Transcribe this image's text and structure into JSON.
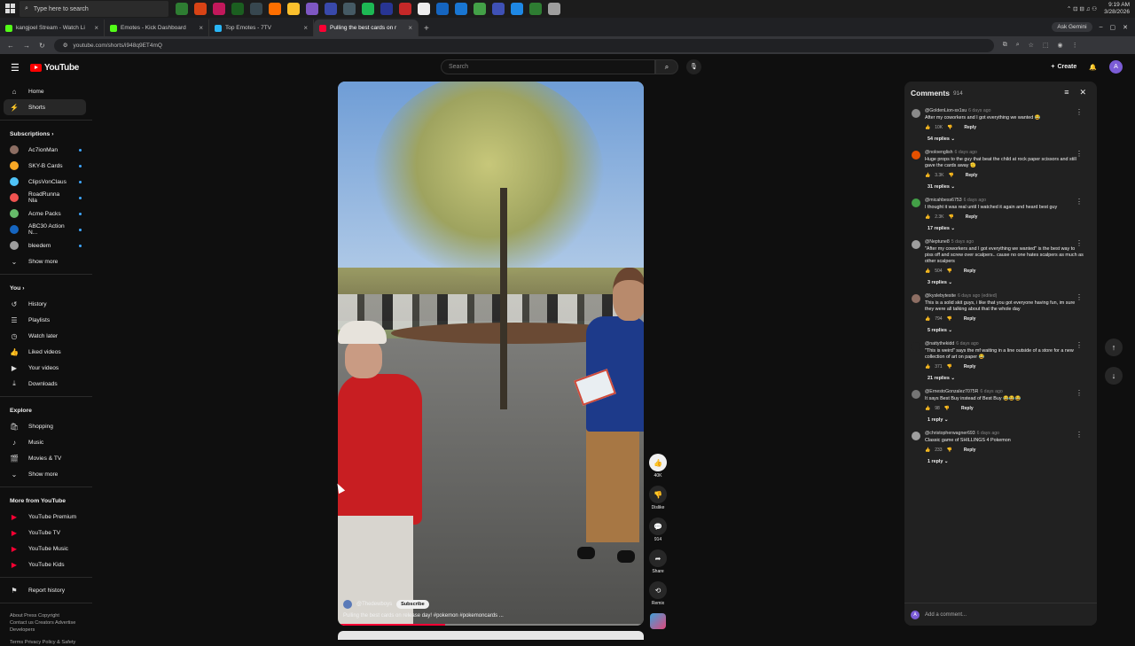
{
  "taskbar": {
    "search_placeholder": "Type here to search",
    "time": "9:19 AM",
    "date": "3/28/2026",
    "app_colors": [
      "#2e7d32",
      "#d84315",
      "#c2185b",
      "#1b5e20",
      "#37474f",
      "#ff6f00",
      "#fbc02d",
      "#7e57c2",
      "#3949ab",
      "#455a64",
      "#1db954",
      "#283593",
      "#c62828",
      "#eeeeee",
      "#1565c0",
      "#1976d2",
      "#43a047",
      "#3f51b5",
      "#1e88e5",
      "#2e7d32",
      "#9e9e9e"
    ]
  },
  "browser": {
    "tabs": [
      {
        "title": "kangjoel Stream - Watch Li",
        "color": "#53fc18"
      },
      {
        "title": "Emotes - Kick Dashboard",
        "color": "#53fc18"
      },
      {
        "title": "Top Emotes - 7TV",
        "color": "#29b6f6"
      },
      {
        "title": "Pulling the best cards on r",
        "color": "#ff0033"
      }
    ],
    "url": "youtube.com/shorts/i948q9ET4mQ",
    "ask_gemini": "Ask Gemini"
  },
  "youtube": {
    "logo_text": "YouTube",
    "search_placeholder": "Search",
    "create_label": "Create",
    "avatar_letter": "A"
  },
  "sidebar": {
    "top": [
      {
        "label": "Home",
        "icon": "home-icon",
        "glyph": "⌂"
      },
      {
        "label": "Shorts",
        "icon": "shorts-icon",
        "glyph": "⚡"
      }
    ],
    "subscriptions_title": "Subscriptions",
    "subscriptions": [
      {
        "label": "Ac7ionMan",
        "color": "#8d6e63"
      },
      {
        "label": "SKY-B Cards",
        "color": "#f9a825"
      },
      {
        "label": "ClipsVonClaus",
        "color": "#4fc3f7"
      },
      {
        "label": "RoadRunna Nla",
        "color": "#ef5350"
      },
      {
        "label": "Acme Packs",
        "color": "#66bb6a"
      },
      {
        "label": "ABC30 Action N...",
        "color": "#1565c0"
      },
      {
        "label": "bleedem",
        "color": "#9e9e9e"
      }
    ],
    "show_more": "Show more",
    "you_title": "You",
    "you_items": [
      {
        "label": "History",
        "icon": "history-icon",
        "glyph": "↺"
      },
      {
        "label": "Playlists",
        "icon": "playlists-icon",
        "glyph": "☰"
      },
      {
        "label": "Watch later",
        "icon": "clock-icon",
        "glyph": "◷"
      },
      {
        "label": "Liked videos",
        "icon": "thumbs-up-icon",
        "glyph": "👍"
      },
      {
        "label": "Your videos",
        "icon": "video-icon",
        "glyph": "▶"
      },
      {
        "label": "Downloads",
        "icon": "download-icon",
        "glyph": "⤓"
      }
    ],
    "explore_title": "Explore",
    "explore_items": [
      {
        "label": "Shopping",
        "icon": "shopping-bag-icon",
        "glyph": "🛍"
      },
      {
        "label": "Music",
        "icon": "music-icon",
        "glyph": "♪"
      },
      {
        "label": "Movies & TV",
        "icon": "film-icon",
        "glyph": "🎬"
      }
    ],
    "explore_show_more": "Show more",
    "more_title": "More from YouTube",
    "more_items": [
      {
        "label": "YouTube Premium",
        "icon": "youtube-premium-icon"
      },
      {
        "label": "YouTube TV",
        "icon": "youtube-tv-icon"
      },
      {
        "label": "YouTube Music",
        "icon": "youtube-music-icon"
      },
      {
        "label": "YouTube Kids",
        "icon": "youtube-kids-icon"
      }
    ],
    "report_history": "Report history",
    "footer_line1": "About  Press  Copyright",
    "footer_line2": "Contact us  Creators  Advertise",
    "footer_line3": "Developers",
    "footer_line4": "Terms  Privacy  Policy & Safety"
  },
  "video": {
    "channel": "@Thedewboys",
    "subscribe": "Subscribe",
    "title": "Pulling the best cards on release day! #pokemon #pokemoncards ...",
    "progress": 0.35,
    "likes": "40K",
    "dislike_label": "Dislike",
    "comments_count": "914",
    "share_label": "Share",
    "remix_label": "Remix"
  },
  "comments": {
    "title": "Comments",
    "count": "914",
    "add_placeholder": "Add a comment...",
    "items": [
      {
        "user": "@GoldenLion-sx1su",
        "time": "6 days ago",
        "text": "After my coworkers and I got everything we wanted 😂",
        "likes": "10K",
        "replies": "54 replies",
        "color": "#8a8a8a"
      },
      {
        "user": "@noloenglish",
        "time": "6 days ago",
        "text": "Huge props to the guy that beat the child at rock paper scissors and still gave the cards away 🫡",
        "likes": "3.3K",
        "replies": "31 replies",
        "color": "#e65100"
      },
      {
        "user": "@micahbess6753",
        "time": "6 days ago",
        "text": "I thought it was real until I watched it again and heard best guy",
        "likes": "2.3K",
        "replies": "17 replies",
        "color": "#43a047"
      },
      {
        "user": "@Neptune8",
        "time": "5 days ago",
        "text": "\"After my coworkers and I got everything we wanted\" is the best way to piss off and screw over scalpers.. cause no one hates scalpers as much as other scalpers",
        "likes": "504",
        "replies": "3 replies",
        "color": "#9e9e9e"
      },
      {
        "user": "@kyslebytesite",
        "time": "6 days ago (edited)",
        "text": "This is a solid skit guys, i like that you got everyone having fun, im sure they were all talking about that the whole day",
        "likes": "794",
        "replies": "5 replies",
        "color": "#8d6e63"
      },
      {
        "user": "@nattythekidd",
        "time": "6 days ago",
        "text": "\"This is weird\" says the mf waiting in a line outside of a store for a new collection of art on paper 😂",
        "likes": "371",
        "replies": "21 replies",
        "color": "#212121"
      },
      {
        "user": "@ErnestoGonzalez7075R",
        "time": "6 days ago",
        "text": "It says Best Buy instead of Best Buy 😂😂😂",
        "likes": "98",
        "replies": "1 reply",
        "color": "#757575"
      },
      {
        "user": "@christopherwagner693",
        "time": "6 days ago",
        "text": "Classic game of SHILLINGS 4 Pokemon",
        "likes": "233",
        "replies": "1 reply",
        "color": "#9e9e9e"
      }
    ]
  }
}
